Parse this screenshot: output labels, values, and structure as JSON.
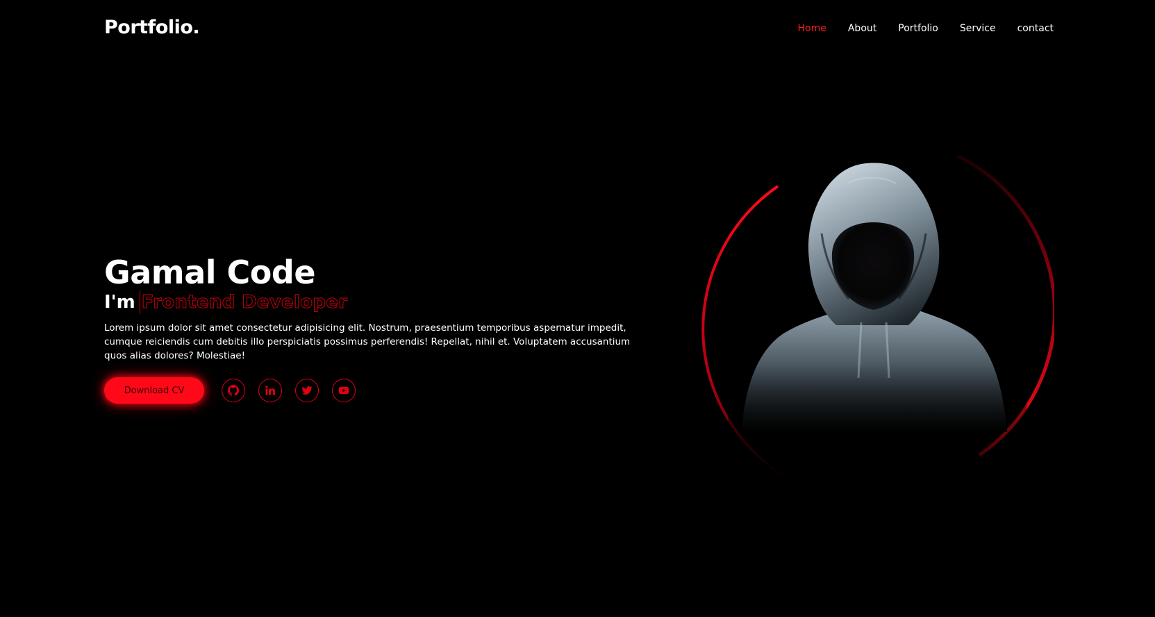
{
  "header": {
    "logo": "Portfolio.",
    "nav": [
      {
        "label": "Home",
        "active": true
      },
      {
        "label": "About",
        "active": false
      },
      {
        "label": "Portfolio",
        "active": false
      },
      {
        "label": "Service",
        "active": false
      },
      {
        "label": "contact",
        "active": false
      }
    ]
  },
  "hero": {
    "name": "Gamal Code",
    "role_prefix": "I'm",
    "role": "Frontend Developer",
    "description": "Lorem ipsum dolor sit amet consectetur adipisicing elit. Nostrum, praesentium temporibus aspernatur impedit, cumque reiciendis cum debitis illo perspiciatis possimus perferendis! Repellat, nihil et. Voluptatem accusantium quos alias dolores? Molestiae!",
    "cv_button": "Download CV",
    "socials": [
      {
        "icon": "github-icon"
      },
      {
        "icon": "linkedin-icon"
      },
      {
        "icon": "twitter-icon"
      },
      {
        "icon": "youtube-icon"
      }
    ]
  },
  "colors": {
    "background": "#000000",
    "accent": "#ff0818",
    "text": "#ffffff"
  }
}
